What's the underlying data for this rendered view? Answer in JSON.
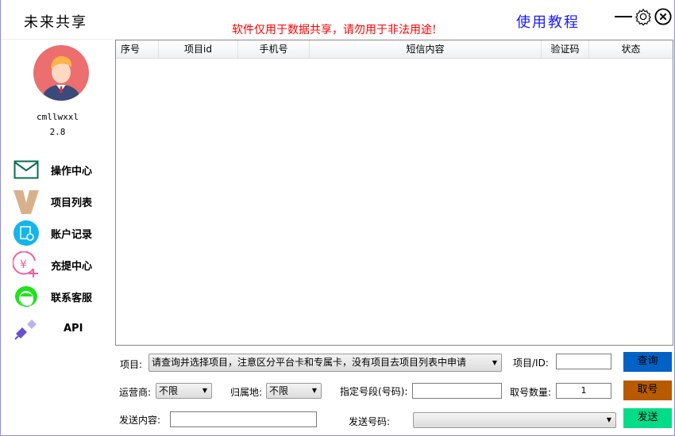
{
  "app": {
    "title": "未来共享",
    "warning": "软件仅用于数据共享，请勿用于非法用途!",
    "tutorial": "使用教程"
  },
  "user": {
    "name": "cmllwxxl",
    "version": "2.8"
  },
  "nav": [
    {
      "label": "操作中心",
      "icon": "mail-icon"
    },
    {
      "label": "项目列表",
      "icon": "v-icon"
    },
    {
      "label": "账户记录",
      "icon": "record-icon"
    },
    {
      "label": "充提中心",
      "icon": "yuan-plus-icon"
    },
    {
      "label": "联系客服",
      "icon": "customer-service-icon"
    },
    {
      "label": "API",
      "icon": "plug-icon"
    }
  ],
  "table": {
    "columns": [
      "序号",
      "项目id",
      "手机号",
      "短信内容",
      "验证码",
      "状态"
    ],
    "rows": []
  },
  "form": {
    "project_label": "项目:",
    "project_value": "请查询并选择项目，注意区分平台卡和专属卡，没有项目去项目列表中申请",
    "project_id_label": "项目/ID:",
    "project_id_value": "",
    "query": "查询",
    "carrier_label": "运营商:",
    "carrier_value": "不限",
    "region_label": "归属地:",
    "region_value": "不限",
    "segment_label": "指定号段(号码):",
    "segment_value": "",
    "count_label": "取号数量:",
    "count_value": "1",
    "get_number": "取号",
    "content_label": "发送内容:",
    "content_value": "",
    "send_number_label": "发送号码:",
    "send_number_value": "",
    "send": "发送"
  },
  "colors": {
    "query": "#0062c4",
    "get_number": "#b85a00",
    "send": "#00dd88",
    "warning": "#ff0000",
    "tutorial": "#1a1aff"
  }
}
